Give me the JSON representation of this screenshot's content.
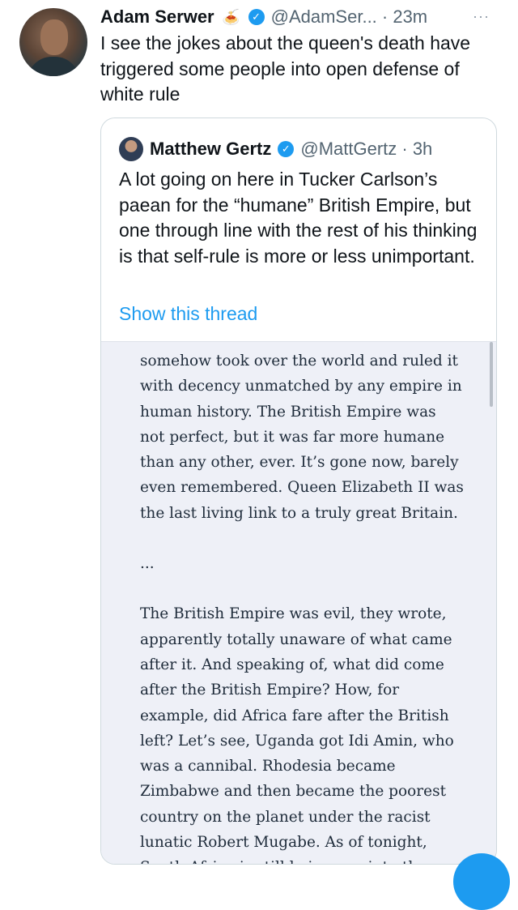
{
  "tweet": {
    "author_name": "Adam Serwer",
    "author_emoji": "🍝",
    "handle_time": "@AdamSer... · 23m",
    "text": "I see the jokes about the queen's death have triggered some people into open defense of white rule"
  },
  "quoted": {
    "author_name": "Matthew Gertz",
    "handle_time": "@MattGertz · 3h",
    "text": "A lot going on here in Tucker Carlson’s paean for the “humane” British Empire, but one through line with the rest of his thinking is that self-rule is more or less unimportant.",
    "link": "Show this thread",
    "article": {
      "para1": "somehow took over the world and ruled it with decency unmatched by any empire in human history. The British Empire was not perfect, but it was far more humane than any other, ever. It’s gone now, barely even remembered. Queen Elizabeth II was the last living link to a truly great Britain.",
      "separator": "...",
      "para2": "The British Empire was evil, they wrote, apparently totally unaware of what came after it. And speaking of, what did come after the British Empire? How, for example, did Africa fare after the British left? Let’s see, Uganda got Idi Amin, who was a cannibal. Rhodesia became Zimbabwe and then became the poorest country on the planet under the racist lunatic Robert Mugabe. As of tonight, South Africa is still being run into the ground by an"
    }
  },
  "icons": {
    "verified": "✓",
    "more": "···"
  },
  "colors": {
    "accent": "#1d9bf0",
    "muted": "#536471",
    "article_bg": "#eef0f7"
  }
}
